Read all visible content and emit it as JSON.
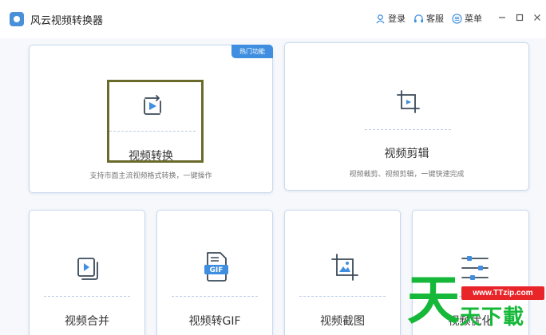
{
  "app": {
    "title": "风云视频转换器"
  },
  "titlebar": {
    "links": {
      "login": "登录",
      "service": "客服",
      "menu": "菜单"
    }
  },
  "cards": {
    "convert": {
      "title": "视频转换",
      "desc": "支持市面主流视频格式转换，一键操作",
      "badge": "热门功能"
    },
    "edit": {
      "title": "视频剪辑",
      "desc": "视频裁剪、视频剪辑，一键快速完成"
    },
    "merge": {
      "title": "视频合并"
    },
    "gif": {
      "title": "视频转GIF",
      "icon_text": "GIF"
    },
    "screenshot": {
      "title": "视频截图"
    },
    "optimize": {
      "title": "视频优化"
    }
  },
  "watermark": {
    "big": "天",
    "url": "www.TTzip.com",
    "small": "天下載"
  },
  "colors": {
    "accent": "#3f8ee0",
    "icon": "#3b4a5a",
    "watermark_green": "#15b838",
    "watermark_red": "#e8262a"
  }
}
